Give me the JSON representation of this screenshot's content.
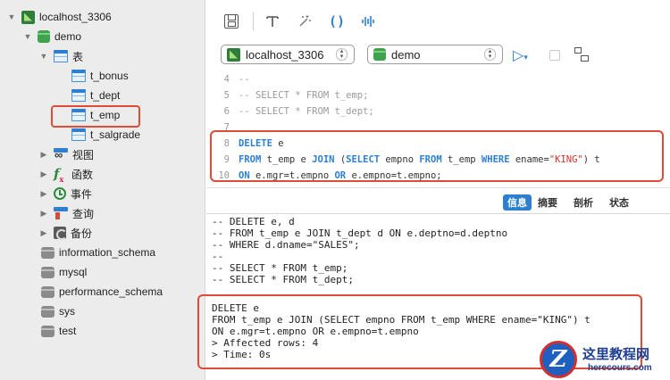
{
  "sidebar": {
    "connection": "localhost_3306",
    "database": "demo",
    "tables_group": "表",
    "tables": [
      "t_bonus",
      "t_dept",
      "t_emp",
      "t_salgrade"
    ],
    "groups": {
      "views": "视图",
      "functions": "函数",
      "events": "事件",
      "queries": "查询",
      "backups": "备份"
    },
    "other_databases": [
      "information_schema",
      "mysql",
      "performance_schema",
      "sys",
      "test"
    ]
  },
  "selectors": {
    "connection": "localhost_3306",
    "database": "demo"
  },
  "editor": {
    "line_numbers": [
      "4",
      "5",
      "6",
      "7",
      "8",
      "9",
      "10"
    ],
    "line4": "--",
    "line5": "-- SELECT * FROM t_emp;",
    "line6": "-- SELECT * FROM t_dept;",
    "line8_kw": "DELETE",
    "line8_rest": " e",
    "line9": {
      "k1": "FROM",
      "t1": " t_emp e ",
      "k2": "JOIN",
      "t2": " (",
      "k3": "SELECT",
      "t3": " empno ",
      "k4": "FROM",
      "t4": " t_emp ",
      "k5": "WHERE",
      "t5": " ename=",
      "s1": "\"KING\"",
      "t6": ") t"
    },
    "line10": {
      "k1": "ON",
      "t1": " e.mgr=t.empno ",
      "k2": "OR",
      "t2": " e.empno=t.empno;"
    }
  },
  "tabs": [
    "信息",
    "摘要",
    "剖析",
    "状态"
  ],
  "output": {
    "lines": [
      "-- DELETE e, d",
      "-- FROM t_emp e JOIN t_dept d ON e.deptno=d.deptno",
      "-- WHERE d.dname=\"SALES\";",
      "--",
      "-- SELECT * FROM t_emp;",
      "-- SELECT * FROM t_dept;",
      "",
      "DELETE e",
      "FROM t_emp e JOIN (SELECT empno FROM t_emp WHERE ename=\"KING\") t",
      "ON e.mgr=t.empno OR e.empno=t.empno",
      "> Affected rows: 4",
      "> Time: 0s"
    ]
  },
  "watermark": {
    "title": "这里教程网",
    "url": "herecours.com"
  }
}
